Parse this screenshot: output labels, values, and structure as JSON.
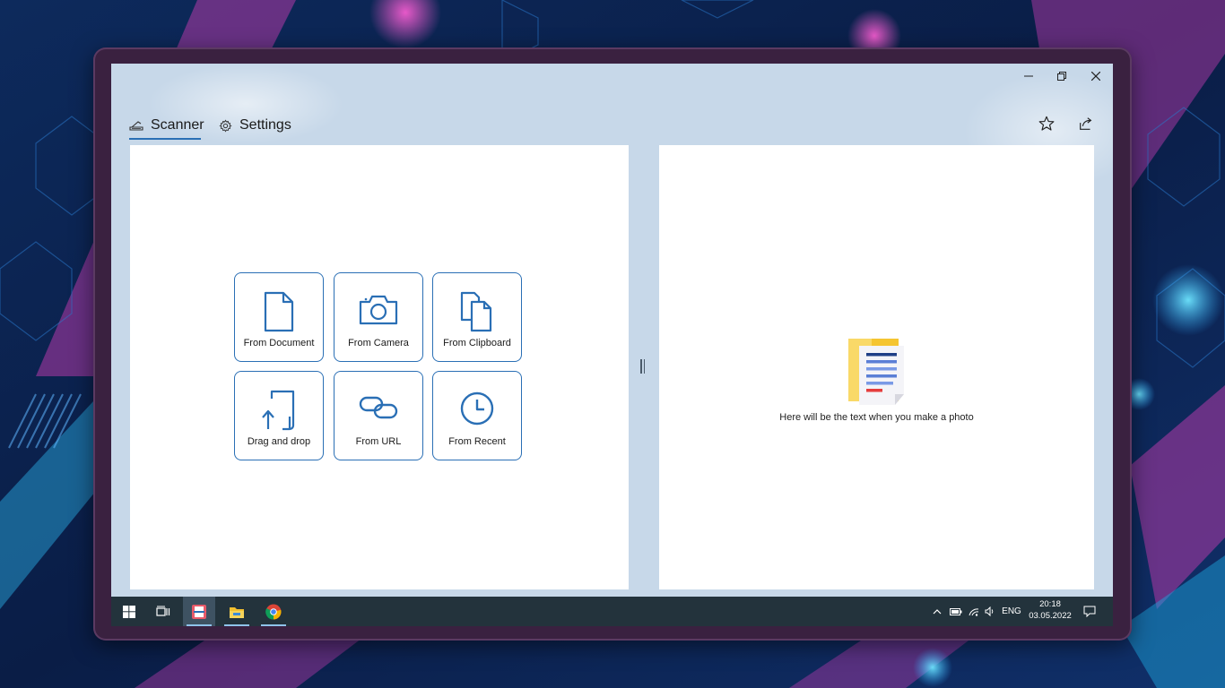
{
  "tabs": [
    {
      "label": "Scanner",
      "icon": "scanner-icon",
      "active": true
    },
    {
      "label": "Settings",
      "icon": "gear-icon",
      "active": false
    }
  ],
  "header_actions": [
    {
      "icon": "star-icon"
    },
    {
      "icon": "share-icon"
    }
  ],
  "window_controls": [
    "minimize-icon",
    "restore-icon",
    "close-icon"
  ],
  "sources": [
    {
      "label": "From Document",
      "icon": "document-icon"
    },
    {
      "label": "From Camera",
      "icon": "camera-icon"
    },
    {
      "label": "From Clipboard",
      "icon": "clipboard-icon"
    },
    {
      "label": "Drag and drop",
      "icon": "upload-file-icon"
    },
    {
      "label": "From URL",
      "icon": "link-icon"
    },
    {
      "label": "From Recent",
      "icon": "clock-icon"
    }
  ],
  "result_panel": {
    "placeholder_text": "Here will be the text when you make a photo",
    "icon": "text-document-illustration"
  },
  "taskbar": {
    "apps": [
      "windows-start-icon",
      "task-view-icon",
      "scanner-app-icon",
      "file-explorer-icon",
      "chrome-icon"
    ],
    "language": "ENG",
    "time": "20:18",
    "date": "03.05.2022"
  },
  "colors": {
    "accent": "#2a6fb5",
    "title_bar_bg": "#c7d8e9",
    "taskbar_bg": "#23333c"
  }
}
